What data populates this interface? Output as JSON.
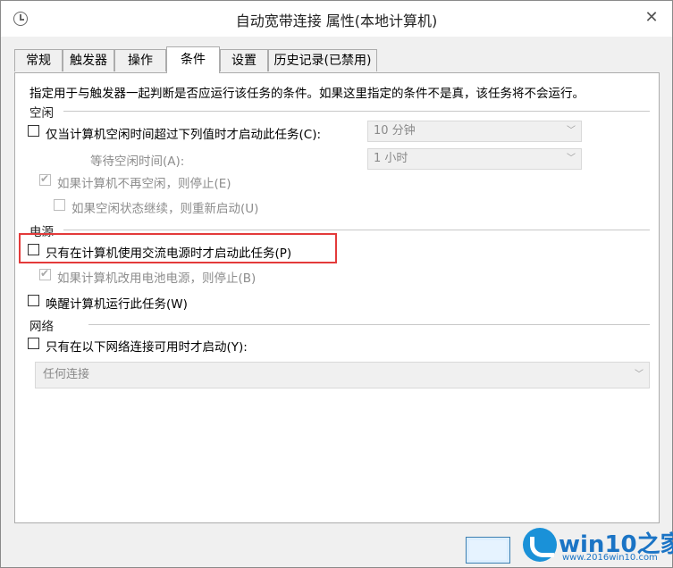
{
  "window": {
    "title": "自动宽带连接 属性(本地计算机)",
    "close_glyph": "✕"
  },
  "tabs": [
    {
      "label": "常规",
      "active": false
    },
    {
      "label": "触发器",
      "active": false
    },
    {
      "label": "操作",
      "active": false
    },
    {
      "label": "条件",
      "active": true
    },
    {
      "label": "设置",
      "active": false
    },
    {
      "label": "历史记录(已禁用)",
      "active": false
    }
  ],
  "conditions": {
    "description": "指定用于与触发器一起判断是否应运行该任务的条件。如果这里指定的条件不是真，该任务将不会运行。",
    "idle": {
      "section_label": "空闲",
      "start_if_idle": {
        "label": "仅当计算机空闲时间超过下列值时才启动此任务(C):",
        "checked": false
      },
      "idle_duration": {
        "value": "10 分钟"
      },
      "wait_label": "等待空闲时间(A):",
      "wait_value": {
        "value": "1 小时"
      },
      "stop_if_not_idle": {
        "label": "如果计算机不再空闲，则停止(E)",
        "checked": true
      },
      "restart_if_idle_resumes": {
        "label": "如果空闲状态继续，则重新启动(U)",
        "checked": false
      }
    },
    "power": {
      "section_label": "电源",
      "start_only_on_ac": {
        "label": "只有在计算机使用交流电源时才启动此任务(P)",
        "checked": false
      },
      "stop_on_battery": {
        "label": "如果计算机改用电池电源，则停止(B)",
        "checked": true
      },
      "wake_to_run": {
        "label": "唤醒计算机运行此任务(W)",
        "checked": false
      }
    },
    "network": {
      "section_label": "网络",
      "start_only_if_network": {
        "label": "只有在以下网络连接可用时才启动(Y):",
        "checked": false
      },
      "connection": {
        "value": "任何连接"
      }
    }
  },
  "watermark": {
    "brand": "win10之家",
    "url": "www.2016win10.com",
    "accent_color": "#1b74c5"
  },
  "icons": {
    "window_icon": "clock-icon",
    "dropdown_icon": "chevron-down-icon",
    "check_icon": "checkmark-icon"
  }
}
